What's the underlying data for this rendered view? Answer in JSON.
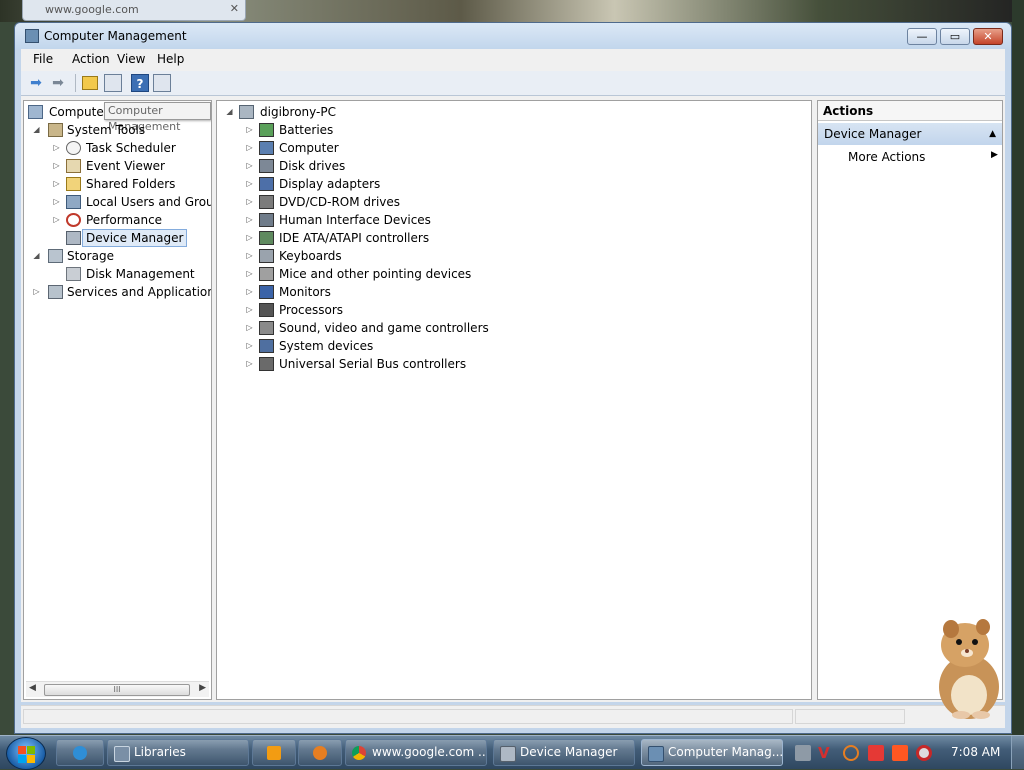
{
  "browser_tab": {
    "title": "www.google.com"
  },
  "window": {
    "title": "Computer Management",
    "controls": {
      "minimize": "—",
      "maximize": "▭",
      "close": "✕"
    }
  },
  "menu": [
    "File",
    "Action",
    "View",
    "Help"
  ],
  "tooltip": "Computer Management",
  "left_tree": {
    "root": "Computer Management (Local)",
    "items": [
      {
        "label": "System Tools",
        "icon": "tools-icon"
      },
      {
        "label": "Task Scheduler",
        "icon": "clock-icon"
      },
      {
        "label": "Event Viewer",
        "icon": "event-viewer-icon"
      },
      {
        "label": "Shared Folders",
        "icon": "shared-folder-icon"
      },
      {
        "label": "Local Users and Groups",
        "icon": "users-icon"
      },
      {
        "label": "Performance",
        "icon": "performance-icon"
      },
      {
        "label": "Device Manager",
        "icon": "device-manager-icon"
      },
      {
        "label": "Storage",
        "icon": "storage-icon"
      },
      {
        "label": "Disk Management",
        "icon": "disk-icon"
      },
      {
        "label": "Services and Applications",
        "icon": "services-icon"
      }
    ],
    "scroll_thumb": "III"
  },
  "devices": {
    "root": "digibrony-PC",
    "items": [
      "Batteries",
      "Computer",
      "Disk drives",
      "Display adapters",
      "DVD/CD-ROM drives",
      "Human Interface Devices",
      "IDE ATA/ATAPI controllers",
      "Keyboards",
      "Mice and other pointing devices",
      "Monitors",
      "Processors",
      "Sound, video and game controllers",
      "System devices",
      "Universal Serial Bus controllers"
    ]
  },
  "actions": {
    "header": "Actions",
    "section": "Device Manager",
    "items": [
      "More Actions"
    ]
  },
  "taskbar": {
    "buttons": [
      "Libraries",
      "www.google.com ...",
      "Device Manager",
      "Computer Manag..."
    ],
    "clock": "7:08 AM"
  },
  "colors": {
    "accent": "#3c6fb4",
    "selection": "#dfeaf7",
    "taskbar": "#425d78"
  }
}
